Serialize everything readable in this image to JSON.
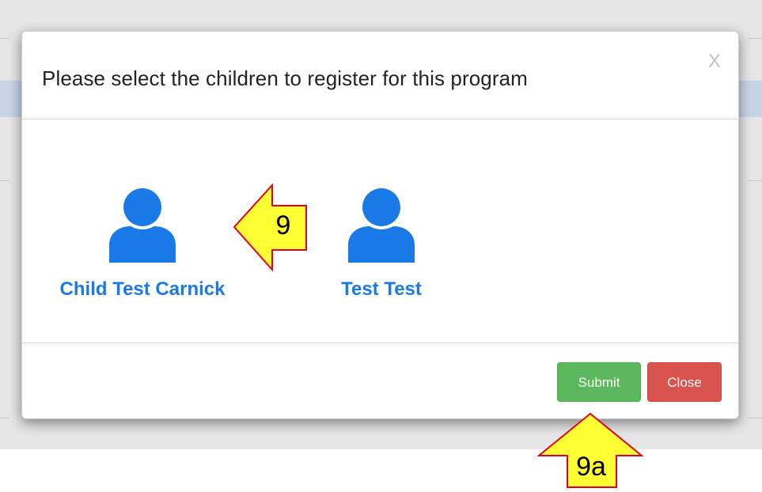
{
  "modal": {
    "title": "Please select the children to register for this program",
    "close_glyph": "X",
    "children": [
      {
        "name": "Child Test Carnick",
        "icon": "user-icon"
      },
      {
        "name": "Test Test",
        "icon": "user-icon"
      }
    ],
    "submit_label": "Submit",
    "close_label": "Close"
  },
  "annotations": {
    "arrow_left_label": "9",
    "arrow_up_label": "9a"
  },
  "colors": {
    "accent_blue": "#1a7be8",
    "submit_green": "#5cb85c",
    "close_red": "#d9534f",
    "callout_fill": "#ffff33",
    "callout_border": "#e8001c"
  }
}
